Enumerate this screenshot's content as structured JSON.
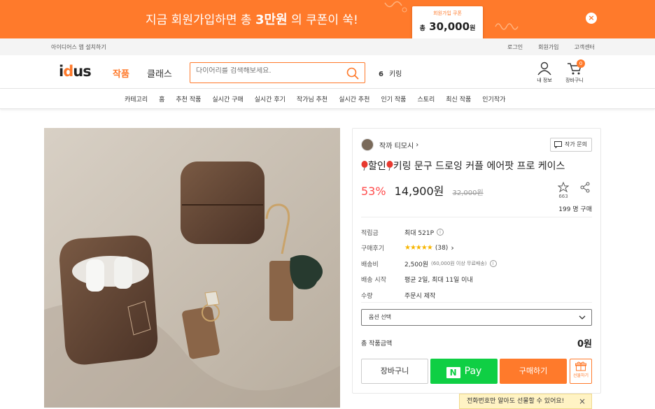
{
  "banner": {
    "text_pre": "지금 회원가입하면 총 ",
    "text_bold": "3만원",
    "text_post": " 의 쿠폰이 쑥!",
    "coupon_label": "회원가입 쿠폰",
    "coupon_prefix": "총",
    "coupon_amount": "30,000",
    "coupon_unit": "원",
    "close_icon": "×"
  },
  "topbar": {
    "app_link": "아이디어스 앱 설치하기",
    "login": "로그인",
    "signup": "회원가입",
    "support": "고객센터"
  },
  "header": {
    "logo_a": "i",
    "logo_b": "d",
    "logo_c": "us",
    "nav_artwork": "작품",
    "nav_class": "클래스",
    "search_placeholder": "다이어리를 검색해보세요.",
    "rank_num": "6",
    "rank_text": "키링",
    "my_label": "내 정보",
    "cart_label": "장바구니",
    "cart_count": "0"
  },
  "categories": [
    "카테고리",
    "홈",
    "추천 작품",
    "실시간 구매",
    "실시간 후기",
    "작가님 추천",
    "실시간 추천",
    "인기 작품",
    "스토리",
    "최신 작품",
    "인기작가"
  ],
  "product": {
    "artist": "작까 티모시",
    "artist_chevron": "›",
    "inquiry": "작가 문의",
    "title_a": "할인",
    "title_b": "키링 문구 드로잉 커플 에어팟 프로 케이스",
    "discount": "53%",
    "price": "14,900원",
    "original_price": "32,000원",
    "fav_count": "663",
    "buyers": "199 명 구매",
    "info": {
      "points_label": "적립금",
      "points_value": "최대 521P",
      "review_label": "구매후기",
      "review_stars": "★★★★★",
      "review_count": "(38)",
      "review_chevron": "›",
      "shipping_label": "배송비",
      "shipping_value": "2,500원",
      "shipping_note": "(60,000원 이상 무료배송)",
      "ship_start_label": "배송 시작",
      "ship_start_value": "평균 2일, 최대 11일 이내",
      "quantity_label": "수량",
      "quantity_value": "주문시 제작"
    },
    "option_select": "옵션 선택",
    "total_label": "총 작품금액",
    "total_value": "0원",
    "btn_cart": "장바구니",
    "npay_n": "N",
    "btn_npay": "Pay",
    "btn_buy": "구매하기",
    "btn_gift": "선물하기",
    "tooltip": "전화번호만 알아도 선물할 수 있어요!",
    "tooltip_close": "×"
  },
  "colors": {
    "accent": "#ff7a2b",
    "npay": "#0fcf44",
    "discount": "#ff4b4b"
  }
}
